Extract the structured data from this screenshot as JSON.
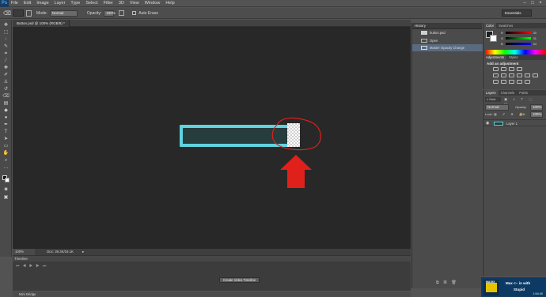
{
  "app": {
    "logo": "Ps"
  },
  "menu": [
    "File",
    "Edit",
    "Image",
    "Layer",
    "Type",
    "Select",
    "Filter",
    "3D",
    "View",
    "Window",
    "Help"
  ],
  "window_controls": [
    "–",
    "□",
    "×"
  ],
  "options": {
    "mode_label": "Mode:",
    "mode_value": "Normal",
    "opacity_label": "Opacity:",
    "opacity_value": "100%",
    "autoerase": "Auto Erase",
    "workspace": "Essentials"
  },
  "document": {
    "tab_title": "Button.psd @ 100% (RGB/8) *",
    "zoom": "100%",
    "doc_info": "Doc: 39.3K/19.1K"
  },
  "timeline": {
    "title": "Timeline",
    "create_button": "Create Video Timeline",
    "bottom_tab": "Mini Bridge"
  },
  "history": {
    "title": "History",
    "items": [
      {
        "label": "button.psd",
        "type": "snapshot"
      },
      {
        "label": "Open",
        "type": "step"
      },
      {
        "label": "Master Opacity Change",
        "type": "step",
        "active": true
      }
    ]
  },
  "color_panel": {
    "tabs": [
      "Color",
      "Swatches"
    ],
    "r": "30",
    "g": "31",
    "b": "34"
  },
  "adjustments": {
    "tabs": [
      "Adjustments",
      "Styles"
    ],
    "heading": "Add an adjustment"
  },
  "layers": {
    "tabs": [
      "Layers",
      "Channels",
      "Paths"
    ],
    "kind_label": "Kind",
    "blend_value": "Normal",
    "opacity_label": "Opacity:",
    "opacity_value": "100%",
    "lock_label": "Lock:",
    "fill_label": "Fill:",
    "fill_value": "100%",
    "layer_name": "Layer 1"
  },
  "ad": {
    "title": "Max <-- in with",
    "subtitle": "Stupid",
    "time": "1:54:40",
    "logo": "MAGIX"
  },
  "colors": {
    "canvas": "#282828",
    "button_border": "#5fd3df",
    "button_fill": "#263c3d",
    "annotation": "#e0201b"
  }
}
